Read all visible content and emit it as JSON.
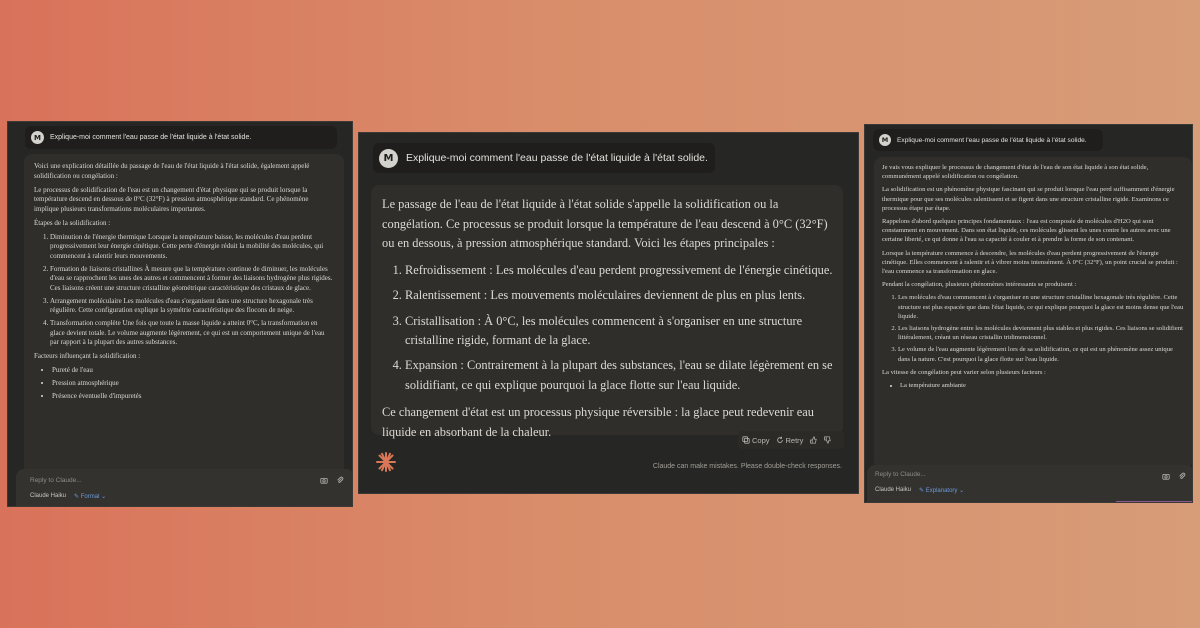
{
  "left": {
    "user_avatar": "M",
    "prompt": "Explique-moi comment l'eau passe de l'état liquide à l'état solide.",
    "intro": "Voici une explication détaillée du passage de l'eau de l'état liquide à l'état solide, également appelé solidification ou congélation :",
    "para1": "Le processus de solidification de l'eau est un changement d'état physique qui se produit lorsque la température descend en dessous de 0°C (32°F) à pression atmosphérique standard. Ce phénomène implique plusieurs transformations moléculaires importantes.",
    "steps_heading": "Étapes de la solidification :",
    "steps": [
      "Diminution de l'énergie thermique Lorsque la température baisse, les molécules d'eau perdent progressivement leur énergie cinétique. Cette perte d'énergie réduit la mobilité des molécules, qui commencent à ralentir leurs mouvements.",
      "Formation de liaisons cristallines À mesure que la température continue de diminuer, les molécules d'eau se rapprochent les unes des autres et commencent à former des liaisons hydrogène plus rigides. Ces liaisons créent une structure cristalline géométrique caractéristique des cristaux de glace.",
      "Arrangement moléculaire Les molécules d'eau s'organisent dans une structure hexagonale très régulière. Cette configuration explique la symétrie caractéristique des flocons de neige.",
      "Transformation complète Une fois que toute la masse liquide a atteint 0°C, la transformation en glace devient totale. Le volume augmente légèrement, ce qui est un comportement unique de l'eau par rapport à la plupart des autres substances."
    ],
    "factors_heading": "Facteurs influençant la solidification :",
    "factors": [
      "Pureté de l'eau",
      "Pression atmosphérique",
      "Présence éventuelle d'impuretés"
    ],
    "reply_placeholder": "Reply to Claude...",
    "model": "Claude Haiku",
    "style": "Formal"
  },
  "middle": {
    "user_avatar": "M",
    "prompt": "Explique-moi comment l'eau passe de l'état liquide à l'état solide.",
    "intro": "Le passage de l'eau de l'état liquide à l'état solide s'appelle la solidification ou la congélation. Ce processus se produit lorsque la température de l'eau descend à 0°C (32°F) ou en dessous, à pression atmosphérique standard. Voici les étapes principales :",
    "steps": [
      "Refroidissement : Les molécules d'eau perdent progressivement de l'énergie cinétique.",
      "Ralentissement : Les mouvements moléculaires deviennent de plus en plus lents.",
      "Cristallisation : À 0°C, les molécules commencent à s'organiser en une structure cristalline rigide, formant de la glace.",
      "Expansion : Contrairement à la plupart des substances, l'eau se dilate légèrement en se solidifiant, ce qui explique pourquoi la glace flotte sur l'eau liquide."
    ],
    "conclusion": "Ce changement d'état est un processus physique réversible : la glace peut redevenir eau liquide en absorbant de la chaleur.",
    "copy_label": "Copy",
    "retry_label": "Retry",
    "disclaimer": "Claude can make mistakes. Please double-check responses."
  },
  "right": {
    "user_avatar": "M",
    "prompt": "Explique-moi comment l'eau passe de l'état liquide à l'état solide.",
    "intro": "Je vais vous expliquer le processus de changement d'état de l'eau de son état liquide à son état solide, communément appelé solidification ou congélation.",
    "para1": "La solidification est un phénomène physique fascinant qui se produit lorsque l'eau perd suffisamment d'énergie thermique pour que ses molécules ralentissent et se figent dans une structure cristalline rigide. Examinons ce processus étape par étape.",
    "para2": "Rappelons d'abord quelques principes fondamentaux : l'eau est composée de molécules d'H2O qui sont constamment en mouvement. Dans son état liquide, ces molécules glissent les unes contre les autres avec une certaine liberté, ce qui donne à l'eau sa capacité à couler et à prendre la forme de son contenant.",
    "para3": "Lorsque la température commence à descendre, les molécules d'eau perdent progressivement de l'énergie cinétique. Elles commencent à ralentir et à vibrer moins intensément. À 0°C (32°F), un point crucial se produit : l'eau commence sa transformation en glace.",
    "para4": "Pendant la congélation, plusieurs phénomènes intéressants se produisent :",
    "phenomena": [
      "Les molécules d'eau commencent à s'organiser en une structure cristalline hexagonale très régulière. Cette structure est plus espacée que dans l'état liquide, ce qui explique pourquoi la glace est moins dense que l'eau liquide.",
      "Les liaisons hydrogène entre les molécules deviennent plus stables et plus rigides. Ces liaisons se solidifient littéralement, créant un réseau cristallin tridimensionnel.",
      "Le volume de l'eau augmente légèrement lors de sa solidification, ce qui est un phénomène assez unique dans la nature. C'est pourquoi la glace flotte sur l'eau liquide."
    ],
    "para5": "La vitesse de congélation peut varier selon plusieurs facteurs :",
    "factors": [
      "La température ambiante"
    ],
    "reply_placeholder": "Reply to Claude...",
    "model": "Claude Haiku",
    "style": "Explanatory"
  },
  "colors": {
    "panel_bg": "#262624",
    "answer_bg": "#2f2e2b",
    "style_accent": "#6d9ad8",
    "spark": "#d97757"
  }
}
